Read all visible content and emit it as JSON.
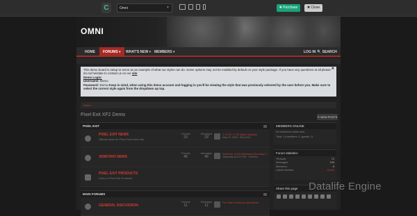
{
  "topbar": {
    "logo_glyph": "C",
    "theme_value": "Omni",
    "purchase_label": "✚ Purchase",
    "close_label": "✖ Close"
  },
  "header": {
    "title": "OMNI"
  },
  "nav": {
    "home": "HOME",
    "forums": "FORUMS ▾",
    "whats_new": "WHAT'S NEW ▾",
    "members": "MEMBERS ▾",
    "login": "LOG IN",
    "search": "🔍 SEARCH"
  },
  "notice": {
    "line1": "This demo board is setup to serve as an example of what our styles can do. Some options may not be enabled by default on your style package. If you have any questions at all please do not hesitate to contact us on our",
    "site_link": "site",
    "demo_login_label": "Demo Login:",
    "username_label": "Username:",
    "username_value": "Demo",
    "password_label": "Password:",
    "password_value": "Demo",
    "password_note": "Keep in mind, when using this demo account and logging in you'll be viewing the style that was previously selected by the user before you. Make sure to select the correct style again from the dropdown up top."
  },
  "breadcrumb": {
    "home": "Home"
  },
  "page": {
    "title": "Pixel Exit XF2 Demo",
    "new_posts_label": "✎ NEW POSTS"
  },
  "categories": [
    {
      "title": "PIXEL EXIT",
      "forums": [
        {
          "name": "PIXEL EXIT NEWS",
          "desc": "Official news for Pixel Exit's beta site",
          "threads_label": "Threads",
          "threads": "23",
          "messages_label": "Messages",
          "messages": "23",
          "last_title": "2.0.0 B / 2.20 Style Updates",
          "last_meta": "May 10, 2018 · Pixel Exit"
        },
        {
          "name": "XENFORO NEWS",
          "desc": "",
          "threads_label": "Threads",
          "threads": "46",
          "messages_label": "Messages",
          "messages": "46",
          "last_title": "XenForo 2.0.5 Released (Security F...",
          "last_meta": "Yesterday at 5:27 PM · XenForo"
        },
        {
          "name": "PIXEL EXIT PRODUCTS",
          "desc": "Links to Pixel Exit Products",
          "threads_label": "",
          "threads": "",
          "messages_label": "",
          "messages": "",
          "last_title": "",
          "last_meta": ""
        }
      ]
    },
    {
      "title": "MAIN FORUMS",
      "forums": [
        {
          "name": "GENERAL DISCUSSION",
          "desc": "",
          "threads_label": "Threads",
          "threads": "11",
          "messages_label": "Messages",
          "messages": "11",
          "last_title": "Pre-Sale Common Questions",
          "last_meta": ""
        }
      ]
    }
  ],
  "sidebar": {
    "members_online": {
      "title": "MEMBERS ONLINE",
      "line1": "No members online now.",
      "line2": "Total: 1 (members: 0, guests: 1)"
    },
    "forum_stats": {
      "title": "Forum statistics",
      "threads_label": "Threads:",
      "threads": "72",
      "messages_label": "Messages:",
      "messages": "190",
      "members_label": "Members:",
      "members": "6",
      "latest_label": "Latest member:",
      "latest": "Demo"
    },
    "share": {
      "title": "Share this page"
    }
  },
  "watermark": "Datalife Engine",
  "colors": {
    "accent": "#a62b24",
    "link": "#d43a30",
    "purchase": "#1aa37a"
  }
}
